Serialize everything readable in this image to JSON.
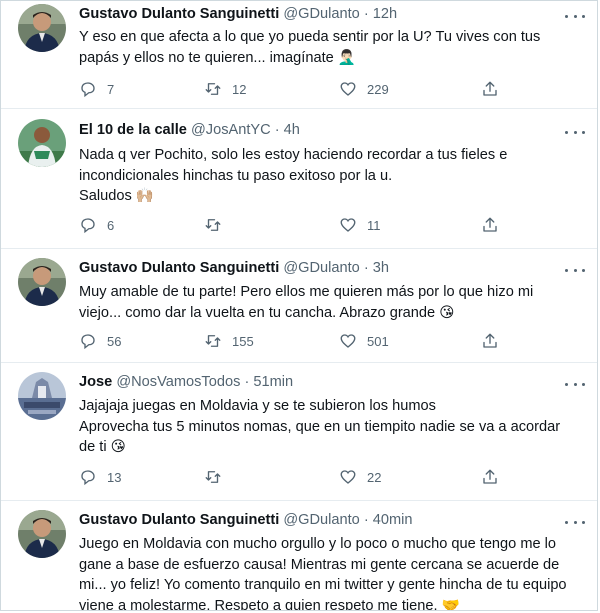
{
  "tweets": [
    {
      "name": "Gustavo Dulanto Sanguinetti",
      "handle": "@GDulanto",
      "time": "12h",
      "lines": [
        "Y eso en que afecta a lo que yo pueda sentir por la U? Tu vives con tus",
        "papás y ellos no te quieren... imagínate 🤦🏻‍♂️"
      ],
      "replies": "7",
      "retweets": "12",
      "likes": "229"
    },
    {
      "name": "El 10 de la calle",
      "handle": "@JosAntYC",
      "time": "4h",
      "lines": [
        "Nada q ver Pochito, solo les estoy haciendo recordar a tus fieles e",
        "incondicionales hinchas tu paso exitoso por la u.",
        "Saludos 🙌🏼"
      ],
      "replies": "6",
      "retweets": "",
      "likes": "11"
    },
    {
      "name": "Gustavo Dulanto Sanguinetti",
      "handle": "@GDulanto",
      "time": "3h",
      "lines": [
        "Muy amable de tu parte! Pero ellos me quieren más por lo que hizo mi",
        "viejo... como dar la vuelta en tu cancha. Abrazo grande 😘"
      ],
      "replies": "56",
      "retweets": "155",
      "likes": "501"
    },
    {
      "name": "Jose",
      "handle": "@NosVamosTodos",
      "time": "51min",
      "lines": [
        "Jajajaja juegas en Moldavia y se te subieron los humos",
        "Aprovecha tus 5 minutos nomas, que en un tiempito nadie se va a acordar",
        "de ti 😘"
      ],
      "replies": "13",
      "retweets": "",
      "likes": "22"
    },
    {
      "name": "Gustavo Dulanto Sanguinetti",
      "handle": "@GDulanto",
      "time": "40min",
      "lines": [
        "Juego en Moldavia con mucho orgullo y lo poco o mucho que tengo me lo",
        "gane a base de esfuerzo causa! Mientras mi gente cercana se acuerde de",
        "mi... yo feliz! Yo comento tranquilo en mi twitter y gente hincha de tu equipo",
        "viene a molestarme. Respeto a quien respeto me tiene. 🤝"
      ],
      "replies": "",
      "retweets": "",
      "likes": ""
    }
  ],
  "separator": "·",
  "icons": {
    "reply": "reply-icon",
    "retweet": "retweet-icon",
    "like": "heart-icon",
    "share": "share-icon",
    "more": "more-icon"
  },
  "colors": {
    "text": "#0f1419",
    "secondary": "#536471",
    "border": "#e6ecf0",
    "thread": "#cfd9de"
  }
}
